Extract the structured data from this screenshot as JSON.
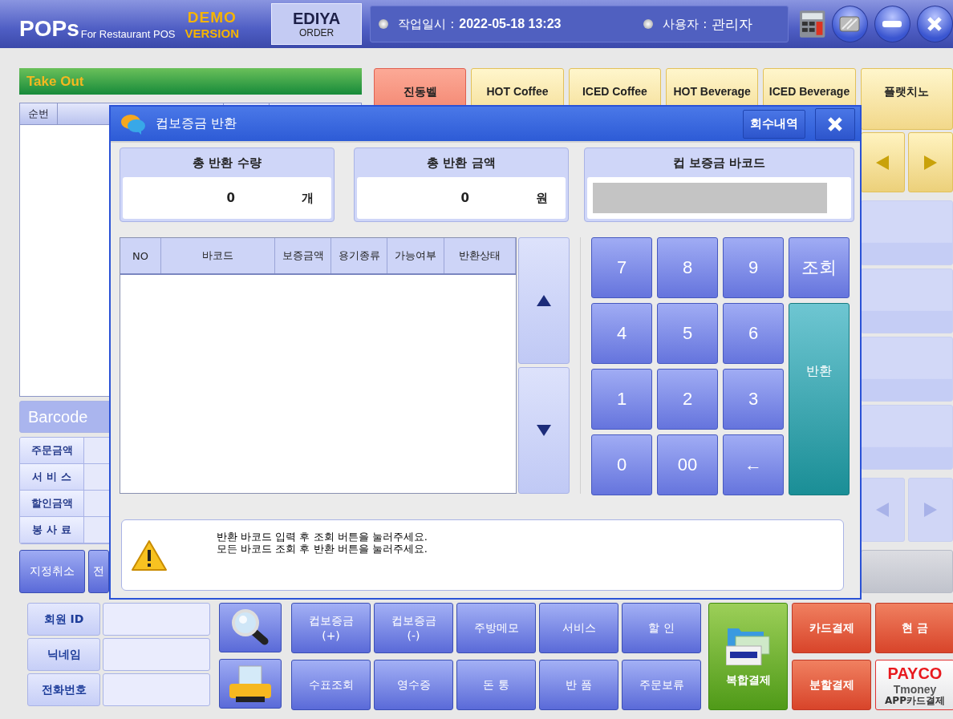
{
  "header": {
    "logo": "POPs",
    "logo_sub": "For Restaurant POS",
    "demo": [
      "DEMO",
      "VERSION"
    ],
    "brand": "EDIYA",
    "brand_sub": "ORDER",
    "work_date_label": "작업일시 :",
    "work_date": "2022-05-18 13:23",
    "user_label": "사용자 :",
    "user": "관리자"
  },
  "order_panel": {
    "title": "Take Out",
    "columns": [
      "순번"
    ],
    "barcode_placeholder": "Barcode",
    "summary": [
      "주문금액",
      "서 비 스",
      "할인금액",
      "봉 사 료"
    ],
    "buttons": [
      "지정취소",
      "전"
    ]
  },
  "categories": [
    {
      "label": "진동벨",
      "selected": true
    },
    {
      "label": "HOT Coffee",
      "selected": false
    },
    {
      "label": "ICED Coffee",
      "selected": false
    },
    {
      "label": "HOT Beverage",
      "selected": false
    },
    {
      "label": "ICED Beverage",
      "selected": false
    },
    {
      "label": "플랫치노",
      "selected": false
    }
  ],
  "member": [
    "회원 ID",
    "닉네임",
    "전화번호"
  ],
  "functions": [
    "컵보증금\n(+)",
    "컵보증금\n(-)",
    "주방메모",
    "서비스",
    "할 인",
    "수표조회",
    "영수증",
    "돈 통",
    "반 품",
    "주문보류"
  ],
  "payments": [
    {
      "label": "복합결제",
      "kind": "combo"
    },
    {
      "label": "카드결제",
      "kind": "red"
    },
    {
      "label": "현 금",
      "kind": "red"
    },
    {
      "label": "분할결제",
      "kind": "red"
    },
    {
      "label": "APP카드결제",
      "kind": "payco",
      "brand": "PAYCO",
      "sub": "Tmoney"
    }
  ],
  "dialog": {
    "title": "컵보증금 반환",
    "history_button": "회수내역",
    "totals": [
      {
        "title": "총 반환 수량",
        "value": "0",
        "unit": "개"
      },
      {
        "title": "총 반환 금액",
        "value": "0",
        "unit": "원"
      }
    ],
    "barcode_title": "컵 보증금 바코드",
    "columns": [
      "NO",
      "바코드",
      "보증금액",
      "용기종류",
      "가능여부",
      "반환상태"
    ],
    "keypad": [
      {
        "label": "7",
        "kind": "key"
      },
      {
        "label": "8",
        "kind": "key"
      },
      {
        "label": "9",
        "kind": "key"
      },
      {
        "label": "조회",
        "kind": "key"
      },
      {
        "label": "4",
        "kind": "key"
      },
      {
        "label": "5",
        "kind": "key"
      },
      {
        "label": "6",
        "kind": "key"
      },
      {
        "label": "반환",
        "kind": "return"
      },
      {
        "label": "1",
        "kind": "key"
      },
      {
        "label": "2",
        "kind": "key"
      },
      {
        "label": "3",
        "kind": "key"
      },
      {
        "label": "0",
        "kind": "key"
      },
      {
        "label": "00",
        "kind": "key"
      },
      {
        "label": "←",
        "kind": "key"
      }
    ],
    "message": [
      "반환 바코드 입력 후 조회 버튼을 눌러주세요.",
      "모든 바코드 조회 후 반환 버튼을 눌러주세요."
    ]
  }
}
